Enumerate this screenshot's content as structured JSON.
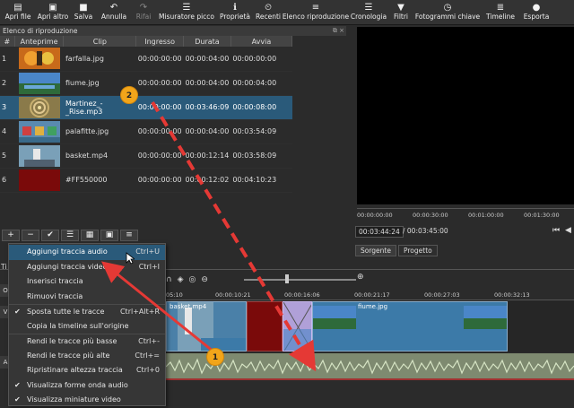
{
  "toolbar": {
    "items": [
      {
        "label": "Apri file",
        "icon": "folder-open-icon",
        "glyph": "▤"
      },
      {
        "label": "Apri altro",
        "icon": "folder-plus-icon",
        "glyph": "▣"
      },
      {
        "label": "Salva",
        "icon": "save-icon",
        "glyph": "■"
      },
      {
        "label": "Annulla",
        "icon": "undo-icon",
        "glyph": "↶"
      },
      {
        "label": "Rifai",
        "icon": "redo-icon",
        "glyph": "↷",
        "disabled": true
      },
      {
        "label": "Misuratore picco",
        "icon": "meter-icon",
        "glyph": "☰"
      },
      {
        "label": "Proprietà",
        "icon": "properties-icon",
        "glyph": "ℹ"
      },
      {
        "label": "Recenti",
        "icon": "recent-icon",
        "glyph": "⏲"
      },
      {
        "label": "Elenco riproduzione",
        "icon": "playlist-icon",
        "glyph": "≡"
      },
      {
        "label": "Cronologia",
        "icon": "history-icon",
        "glyph": "☰"
      },
      {
        "label": "Filtri",
        "icon": "filter-icon",
        "glyph": "▼"
      },
      {
        "label": "Fotogrammi chiave",
        "icon": "keyframes-icon",
        "glyph": "◷"
      },
      {
        "label": "Timeline",
        "icon": "timeline-icon",
        "glyph": "≣"
      },
      {
        "label": "Esporta",
        "icon": "export-icon",
        "glyph": "●"
      }
    ]
  },
  "playlist": {
    "title": "Elenco di riproduzione",
    "close": "⧉ ×",
    "columns": [
      "#",
      "Anteprime",
      "Clip",
      "Ingresso",
      "Durata",
      "Avvia"
    ],
    "rows": [
      {
        "n": "1",
        "clip": "farfalla.jpg",
        "in": "00:00:00:00",
        "dur": "00:00:04:00",
        "start": "00:00:00:00"
      },
      {
        "n": "2",
        "clip": "fiume.jpg",
        "in": "00:00:00:00",
        "dur": "00:00:04:00",
        "start": "00:00:04:00"
      },
      {
        "n": "3",
        "clip": "Martinez_-_Rise.mp3",
        "in": "00:00:00:00",
        "dur": "00:03:46:09",
        "start": "00:00:08:00",
        "selected": true
      },
      {
        "n": "4",
        "clip": "palafitte.jpg",
        "in": "00:00:00:00",
        "dur": "00:00:04:00",
        "start": "00:03:54:09"
      },
      {
        "n": "5",
        "clip": "basket.mp4",
        "in": "00:00:00:00",
        "dur": "00:00:12:14",
        "start": "00:03:58:09"
      },
      {
        "n": "6",
        "clip": "#FF550000",
        "in": "00:00:00:00",
        "dur": "00:00:12:02",
        "start": "00:04:10:23"
      }
    ],
    "toolbar": [
      "+",
      "−",
      "✔",
      "☰",
      "▦",
      "▣",
      "≡"
    ]
  },
  "player": {
    "ruler": [
      "00:00:00:00",
      "00:00:30:00",
      "00:01:00:00",
      "00:01:30:00"
    ],
    "current_time": "00:03:44:24",
    "total_time": "/ 00:03:45:00",
    "tabs": [
      "Sorgente",
      "Progetto"
    ]
  },
  "timeline": {
    "track_label": "Ti",
    "ruler": [
      "05:10",
      "00:00:10:21",
      "00:00:16:06",
      "00:00:21:17",
      "00:00:27:03",
      "00:00:32:13"
    ],
    "clips": [
      {
        "name": "basket.mp4"
      },
      {
        "name": "fiume.jpg"
      }
    ],
    "side_labels": [
      "O",
      "V",
      "A"
    ]
  },
  "context_menu": {
    "items": [
      {
        "label": "Aggiungi traccia audio",
        "shortcut": "Ctrl+U",
        "highlighted": true
      },
      {
        "label": "Aggiungi traccia video",
        "shortcut": "Ctrl+I"
      },
      {
        "label": "Inserisci traccia",
        "shortcut": ""
      },
      {
        "label": "Rimuovi traccia",
        "shortcut": ""
      },
      {
        "label": "Sposta tutte le tracce",
        "shortcut": "Ctrl+Alt+R",
        "checked": true,
        "sep": true
      },
      {
        "label": "Copia la timeline sull'origine",
        "shortcut": ""
      },
      {
        "label": "Rendi le tracce più basse",
        "shortcut": "Ctrl+-",
        "sep": true
      },
      {
        "label": "Rendi le tracce più alte",
        "shortcut": "Ctrl+="
      },
      {
        "label": "Ripristinare altezza traccia",
        "shortcut": "Ctrl+0"
      },
      {
        "label": "Visualizza forme onda audio",
        "shortcut": "",
        "checked": true
      },
      {
        "label": "Visualizza miniature video",
        "shortcut": "",
        "checked": true
      }
    ]
  },
  "annotations": {
    "badge1": "1",
    "badge2": "2",
    "arrow_color": "#e53935",
    "badge_color": "#f2a51a"
  }
}
